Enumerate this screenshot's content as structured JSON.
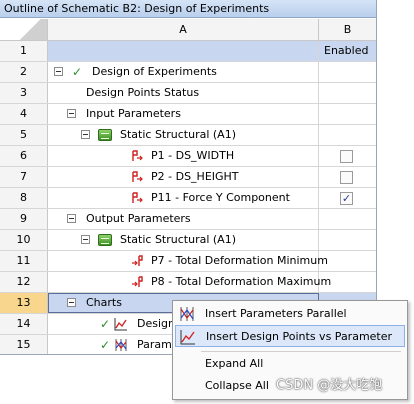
{
  "window": {
    "title": "Outline of Schematic B2: Design of Experiments"
  },
  "columns": {
    "a": "A",
    "b": "B"
  },
  "rows": [
    {
      "num": "1",
      "label": "",
      "b": "Enabled"
    },
    {
      "num": "2",
      "label": "Design of Experiments"
    },
    {
      "num": "3",
      "label": "Design Points Status"
    },
    {
      "num": "4",
      "label": "Input Parameters"
    },
    {
      "num": "5",
      "label": "Static Structural (A1)"
    },
    {
      "num": "6",
      "label": "P1 - DS_WIDTH",
      "checked": false
    },
    {
      "num": "7",
      "label": "P2 - DS_HEIGHT",
      "checked": false
    },
    {
      "num": "8",
      "label": "P11 - Force Y Component",
      "checked": true
    },
    {
      "num": "9",
      "label": "Output Parameters"
    },
    {
      "num": "10",
      "label": "Static Structural (A1)"
    },
    {
      "num": "11",
      "label": "P7 - Total Deformation Minimum"
    },
    {
      "num": "12",
      "label": "P8 - Total Deformation Maximum"
    },
    {
      "num": "13",
      "label": "Charts"
    },
    {
      "num": "14",
      "label": "Design"
    },
    {
      "num": "15",
      "label": "Parame"
    }
  ],
  "context_menu": {
    "items": [
      {
        "label": "Insert Parameters Parallel",
        "icon": "parallel-chart-icon"
      },
      {
        "label": "Insert Design Points vs Parameter",
        "icon": "line-chart-icon"
      },
      {
        "label": "Expand All"
      },
      {
        "label": "Collapse All"
      }
    ]
  },
  "watermark": "CSDN @没大吃饱",
  "colors": {
    "selection": "#c8d6f0",
    "selected_row_number": "#f9d68d",
    "menu_hover": "#dce8fa"
  }
}
